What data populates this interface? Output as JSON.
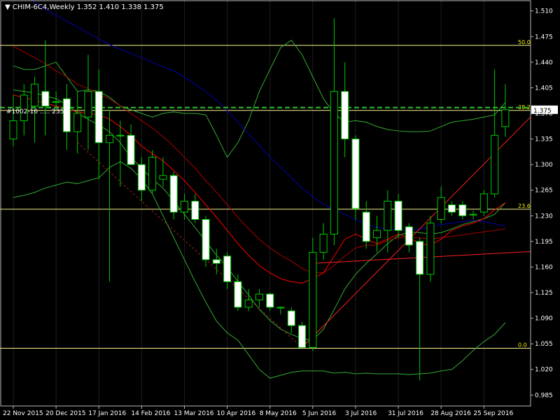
{
  "header": {
    "label": "▼ CHIM-6C4,Weekly  1.352 1.410 1.338 1.375"
  },
  "overlay_text": "#1002-16 ..... 2355",
  "price_badge": "1.375",
  "colors": {
    "background": "#000000",
    "grid": "#b7b7b7",
    "bull_candle": "#000000",
    "bear_candle": "#ffffff",
    "wick": "#00c800",
    "fib_line": "#f3f38c",
    "fib_label": "#f0f000",
    "ma_fast": "#ff0000",
    "ma_mid": "#aa0000",
    "ma_slow": "#0000b0",
    "bands": "#33aa33",
    "channel": "#ff2020",
    "channel_dashed": "#aa2020",
    "dashed_green": "#2fc62f",
    "axis_text": "#ffffff"
  },
  "chart_data": {
    "type": "candlestick",
    "symbol": "CHIM-6C4",
    "timeframe": "Weekly",
    "last_ohlc": {
      "open": 1.352,
      "high": 1.41,
      "low": 1.338,
      "close": 1.375
    },
    "ylim": [
      0.97,
      1.525
    ],
    "y_ticks": [
      "1.510",
      "1.475",
      "1.440",
      "1.405",
      "1.370",
      "1.335",
      "1.300",
      "1.265",
      "1.230",
      "1.195",
      "1.160",
      "1.125",
      "1.090",
      "1.055",
      "1.020",
      "0.985"
    ],
    "x_labels": [
      "22 Nov 2015",
      "20 Dec 2015",
      "17 Jan 2016",
      "14 Feb 2016",
      "13 Mar 2016",
      "10 Apr 2016",
      "8 May 2016",
      "5 Jun 2016",
      "3 Jul 2016",
      "31 Jul 2016",
      "28 Aug 2016",
      "25 Sep 2016"
    ],
    "candles": [
      {
        "o": 1.335,
        "h": 1.395,
        "l": 1.325,
        "c": 1.36
      },
      {
        "o": 1.36,
        "h": 1.41,
        "l": 1.34,
        "c": 1.395
      },
      {
        "o": 1.38,
        "h": 1.42,
        "l": 1.33,
        "c": 1.41
      },
      {
        "o": 1.4,
        "h": 1.47,
        "l": 1.34,
        "c": 1.38
      },
      {
        "o": 1.385,
        "h": 1.4,
        "l": 1.375,
        "c": 1.386
      },
      {
        "o": 1.39,
        "h": 1.41,
        "l": 1.32,
        "c": 1.345
      },
      {
        "o": 1.345,
        "h": 1.4,
        "l": 1.315,
        "c": 1.37
      },
      {
        "o": 1.365,
        "h": 1.45,
        "l": 1.32,
        "c": 1.4
      },
      {
        "o": 1.4,
        "h": 1.43,
        "l": 1.28,
        "c": 1.33
      },
      {
        "o": 1.33,
        "h": 1.375,
        "l": 1.14,
        "c": 1.34
      },
      {
        "o": 1.34,
        "h": 1.36,
        "l": 1.27,
        "c": 1.34
      },
      {
        "o": 1.34,
        "h": 1.355,
        "l": 1.3,
        "c": 1.3
      },
      {
        "o": 1.3,
        "h": 1.31,
        "l": 1.25,
        "c": 1.265
      },
      {
        "o": 1.265,
        "h": 1.32,
        "l": 1.26,
        "c": 1.31
      },
      {
        "o": 1.28,
        "h": 1.31,
        "l": 1.27,
        "c": 1.285
      },
      {
        "o": 1.285,
        "h": 1.29,
        "l": 1.225,
        "c": 1.235
      },
      {
        "o": 1.235,
        "h": 1.26,
        "l": 1.225,
        "c": 1.25
      },
      {
        "o": 1.25,
        "h": 1.26,
        "l": 1.22,
        "c": 1.225
      },
      {
        "o": 1.225,
        "h": 1.23,
        "l": 1.16,
        "c": 1.17
      },
      {
        "o": 1.17,
        "h": 1.185,
        "l": 1.15,
        "c": 1.165
      },
      {
        "o": 1.175,
        "h": 1.18,
        "l": 1.13,
        "c": 1.14
      },
      {
        "o": 1.14,
        "h": 1.15,
        "l": 1.1,
        "c": 1.105
      },
      {
        "o": 1.105,
        "h": 1.13,
        "l": 1.1,
        "c": 1.115
      },
      {
        "o": 1.115,
        "h": 1.13,
        "l": 1.105,
        "c": 1.123
      },
      {
        "o": 1.123,
        "h": 1.125,
        "l": 1.1,
        "c": 1.105
      },
      {
        "o": 1.104,
        "h": 1.106,
        "l": 1.095,
        "c": 1.105
      },
      {
        "o": 1.1,
        "h": 1.105,
        "l": 1.07,
        "c": 1.08
      },
      {
        "o": 1.08,
        "h": 1.085,
        "l": 1.05,
        "c": 1.05
      },
      {
        "o": 1.05,
        "h": 1.2,
        "l": 1.045,
        "c": 1.18
      },
      {
        "o": 1.18,
        "h": 1.22,
        "l": 1.17,
        "c": 1.205
      },
      {
        "o": 1.205,
        "h": 1.5,
        "l": 1.19,
        "c": 1.4
      },
      {
        "o": 1.4,
        "h": 1.44,
        "l": 1.31,
        "c": 1.335
      },
      {
        "o": 1.335,
        "h": 1.34,
        "l": 1.225,
        "c": 1.24
      },
      {
        "o": 1.235,
        "h": 1.25,
        "l": 1.185,
        "c": 1.195
      },
      {
        "o": 1.2,
        "h": 1.23,
        "l": 1.18,
        "c": 1.21
      },
      {
        "o": 1.21,
        "h": 1.265,
        "l": 1.18,
        "c": 1.25
      },
      {
        "o": 1.25,
        "h": 1.26,
        "l": 1.2,
        "c": 1.21
      },
      {
        "o": 1.215,
        "h": 1.22,
        "l": 1.18,
        "c": 1.19
      },
      {
        "o": 1.195,
        "h": 1.2,
        "l": 1.005,
        "c": 1.15
      },
      {
        "o": 1.15,
        "h": 1.23,
        "l": 1.14,
        "c": 1.22
      },
      {
        "o": 1.225,
        "h": 1.27,
        "l": 1.22,
        "c": 1.255
      },
      {
        "o": 1.245,
        "h": 1.25,
        "l": 1.23,
        "c": 1.235
      },
      {
        "o": 1.245,
        "h": 1.25,
        "l": 1.225,
        "c": 1.23
      },
      {
        "o": 1.232,
        "h": 1.237,
        "l": 1.225,
        "c": 1.232
      },
      {
        "o": 1.235,
        "h": 1.265,
        "l": 1.23,
        "c": 1.26
      },
      {
        "o": 1.26,
        "h": 1.43,
        "l": 1.255,
        "c": 1.34
      },
      {
        "o": 1.352,
        "h": 1.41,
        "l": 1.338,
        "c": 1.375
      }
    ],
    "fibonacci_levels": [
      {
        "label": "50.0",
        "value": 1.463
      },
      {
        "label": "38.2",
        "value": 1.374
      },
      {
        "label": "23.6",
        "value": 1.239
      },
      {
        "label": "0.0",
        "value": 1.049
      }
    ],
    "dashed_level": 1.378,
    "indicators": {
      "ma_fast": [
        1.395,
        1.392,
        1.388,
        1.384,
        1.38,
        1.376,
        1.372,
        1.37,
        1.368,
        1.362,
        1.352,
        1.34,
        1.325,
        1.315,
        1.305,
        1.292,
        1.278,
        1.262,
        1.245,
        1.228,
        1.21,
        1.192,
        1.176,
        1.162,
        1.152,
        1.144,
        1.14,
        1.138,
        1.144,
        1.152,
        1.175,
        1.198,
        1.205,
        1.198,
        1.192,
        1.198,
        1.205,
        1.2,
        1.192,
        1.19,
        1.198,
        1.21,
        1.216,
        1.22,
        1.226,
        1.238,
        1.248
      ],
      "ma_mid": [
        1.462,
        1.454,
        1.446,
        1.438,
        1.428,
        1.42,
        1.41,
        1.404,
        1.396,
        1.39,
        1.38,
        1.37,
        1.36,
        1.35,
        1.338,
        1.325,
        1.31,
        1.295,
        1.278,
        1.262,
        1.245,
        1.228,
        1.212,
        1.198,
        1.186,
        1.176,
        1.168,
        1.158,
        1.152,
        1.152,
        1.162,
        1.175,
        1.186,
        1.19,
        1.19,
        1.196,
        1.2,
        1.2,
        1.2,
        1.198,
        1.2,
        1.202,
        1.204,
        1.206,
        1.208,
        1.21,
        1.212
      ],
      "ma_slow": [
        1.54,
        1.532,
        1.522,
        1.512,
        1.504,
        1.496,
        1.488,
        1.48,
        1.472,
        1.464,
        1.458,
        1.452,
        1.446,
        1.44,
        1.434,
        1.428,
        1.42,
        1.41,
        1.4,
        1.388,
        1.374,
        1.358,
        1.342,
        1.326,
        1.31,
        1.296,
        1.282,
        1.268,
        1.256,
        1.246,
        1.238,
        1.232,
        1.225,
        1.218,
        1.214,
        1.212,
        1.211,
        1.21,
        1.212,
        1.214,
        1.218,
        1.22,
        1.222,
        1.224,
        1.222,
        1.219,
        1.216
      ],
      "band_upper": [
        1.435,
        1.43,
        1.43,
        1.435,
        1.44,
        1.42,
        1.4,
        1.402,
        1.4,
        1.392,
        1.38,
        1.375,
        1.37,
        1.365,
        1.37,
        1.372,
        1.37,
        1.37,
        1.368,
        1.34,
        1.31,
        1.33,
        1.36,
        1.4,
        1.43,
        1.46,
        1.47,
        1.45,
        1.42,
        1.39,
        1.37,
        1.358,
        1.36,
        1.358,
        1.352,
        1.348,
        1.346,
        1.345,
        1.345,
        1.346,
        1.352,
        1.358,
        1.36,
        1.362,
        1.365,
        1.368,
        1.385
      ],
      "band_mid": [
        1.402,
        1.4,
        1.398,
        1.394,
        1.39,
        1.382,
        1.37,
        1.362,
        1.354,
        1.345,
        1.33,
        1.31,
        1.295,
        1.28,
        1.268,
        1.25,
        1.232,
        1.214,
        1.195,
        1.176,
        1.16,
        1.14,
        1.122,
        1.102,
        1.087,
        1.075,
        1.068,
        1.062,
        1.06,
        1.075,
        1.102,
        1.13,
        1.15,
        1.165,
        1.178,
        1.192,
        1.203,
        1.208,
        1.207,
        1.205,
        1.207,
        1.212,
        1.218,
        1.222,
        1.226,
        1.232,
        1.248
      ],
      "band_lower": [
        1.255,
        1.258,
        1.262,
        1.268,
        1.272,
        1.276,
        1.274,
        1.278,
        1.282,
        1.296,
        1.304,
        1.295,
        1.28,
        1.26,
        1.23,
        1.2,
        1.17,
        1.14,
        1.112,
        1.086,
        1.07,
        1.06,
        1.04,
        1.02,
        1.008,
        1.012,
        1.016,
        1.018,
        1.018,
        1.018,
        1.015,
        1.016,
        1.014,
        1.015,
        1.014,
        1.014,
        1.014,
        1.013,
        1.014,
        1.015,
        1.018,
        1.02,
        1.032,
        1.046,
        1.058,
        1.068,
        1.084
      ]
    },
    "trendlines": [
      {
        "style": "solid",
        "points": [
          [
            27,
            1.05
          ],
          [
            47,
            1.345
          ]
        ]
      },
      {
        "style": "solid",
        "points": [
          [
            28,
            1.165
          ],
          [
            47,
            1.18
          ]
        ]
      },
      {
        "style": "dashed",
        "points": [
          [
            6,
            1.33
          ],
          [
            27,
            1.05
          ]
        ]
      }
    ]
  }
}
